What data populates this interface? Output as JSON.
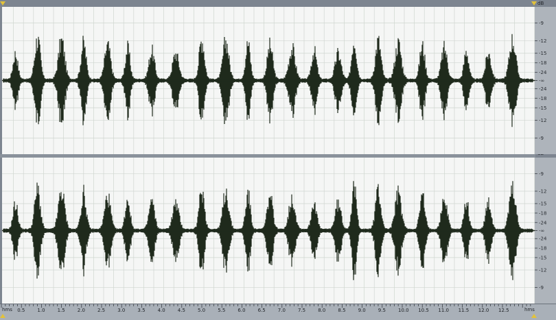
{
  "app": {
    "view": "waveform-editor",
    "channels": 2
  },
  "colors": {
    "waveform": "#1f2a1c",
    "background": "#f5f6f5",
    "grid": "#cfd6d0",
    "frame": "#7d8590",
    "marker": "#e2c23a"
  },
  "db_scale": {
    "unit": "dB",
    "labels": [
      "-9",
      "-12",
      "-15",
      "-18",
      "-24",
      "-∞",
      "-24",
      "-18",
      "-15",
      "-12",
      "-9"
    ]
  },
  "time_ruler": {
    "unit_left": "hms",
    "unit_right": "hms",
    "ticks": [
      "0.5",
      "1.0",
      "1.5",
      "2.0",
      "2.5",
      "3.0",
      "3.5",
      "4.0",
      "4.5",
      "5.0",
      "5.5",
      "6.0",
      "6.5",
      "7.0",
      "7.5",
      "8.0",
      "8.5",
      "9.0",
      "9.5",
      "10.0",
      "10.5",
      "11.0",
      "11.5",
      "12.0",
      "12.5"
    ]
  },
  "audio": {
    "duration_seconds": 13.2,
    "bursts": [
      0.3,
      0.85,
      1.45,
      2.0,
      2.6,
      3.1,
      3.7,
      4.3,
      4.95,
      5.55,
      6.1,
      6.65,
      7.2,
      7.75,
      8.35,
      8.75,
      9.35,
      9.85,
      10.45,
      11.0,
      11.55,
      12.1,
      12.7
    ]
  }
}
